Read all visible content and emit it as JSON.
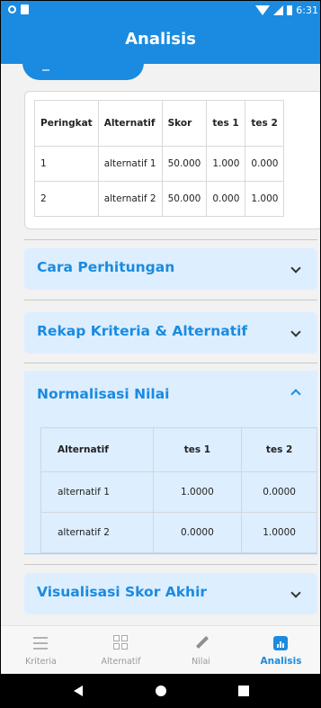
{
  "status_bar": {
    "time": "6:31"
  },
  "app_bar": {
    "title": "Analisis"
  },
  "ranking_table": {
    "headers": [
      "Peringkat",
      "Alternatif",
      "Skor",
      "tes 1",
      "tes 2"
    ],
    "rows": [
      [
        "1",
        "alternatif 1",
        "50.000",
        "1.000",
        "0.000"
      ],
      [
        "2",
        "alternatif 2",
        "50.000",
        "0.000",
        "1.000"
      ]
    ]
  },
  "sections": {
    "cara_perhitungan": {
      "title": "Cara Perhitungan",
      "expanded": false
    },
    "rekap": {
      "title": "Rekap Kriteria & Alternatif",
      "expanded": false
    },
    "normalisasi": {
      "title": "Normalisasi Nilai",
      "expanded": true
    },
    "visualisasi": {
      "title": "Visualisasi Skor Akhir",
      "expanded": false
    }
  },
  "normalization_table": {
    "headers": [
      "Alternatif",
      "tes 1",
      "tes 2"
    ],
    "rows": [
      [
        "alternatif 1",
        "1.0000",
        "0.0000"
      ],
      [
        "alternatif 2",
        "0.0000",
        "1.0000"
      ]
    ]
  },
  "bottom_nav": {
    "items": [
      {
        "label": "Kriteria",
        "icon": "list-icon",
        "active": false
      },
      {
        "label": "Alternatif",
        "icon": "grid-icon",
        "active": false
      },
      {
        "label": "Nilai",
        "icon": "pencil-icon",
        "active": false
      },
      {
        "label": "Analisis",
        "icon": "bar-chart-icon",
        "active": true
      }
    ]
  },
  "colors": {
    "primary": "#1a8be0",
    "panel": "#ddeeff",
    "background": "#f2f2f2"
  }
}
